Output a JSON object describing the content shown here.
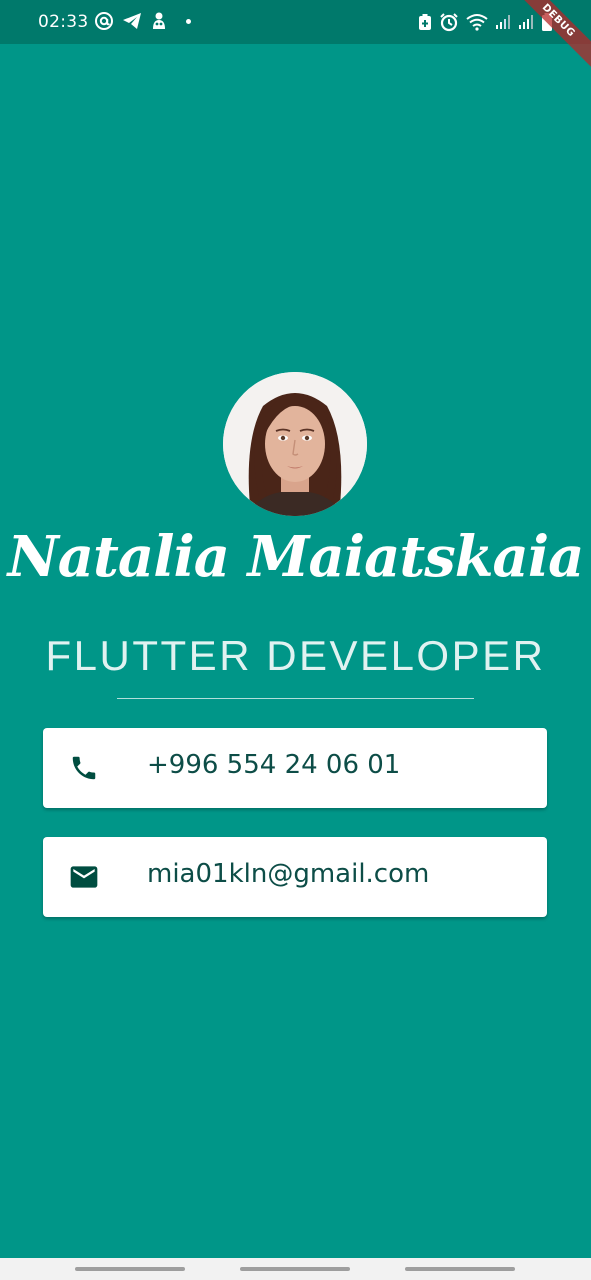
{
  "status_bar": {
    "time": "02:33",
    "left_icons": [
      "at-sign-icon",
      "telegram-icon",
      "app-notification-icon",
      "dot-icon"
    ],
    "right_icons": [
      "battery-saver-icon",
      "alarm-icon",
      "wifi-icon",
      "signal-icon",
      "signal-icon-2",
      "battery-icon"
    ]
  },
  "debug_banner": "DEBUG",
  "profile": {
    "name": "Natalia Maiatskaia",
    "title": "FLUTTER DEVELOPER"
  },
  "contacts": {
    "phone": {
      "icon": "phone-icon",
      "value": "+996 554 24 06 01"
    },
    "email": {
      "icon": "mail-icon",
      "value": "mia01kln@gmail.com"
    }
  },
  "colors": {
    "background": "#009688",
    "status_bar": "#00796b",
    "card": "#ffffff",
    "card_text": "#0d4d47",
    "icon": "#004d40"
  }
}
